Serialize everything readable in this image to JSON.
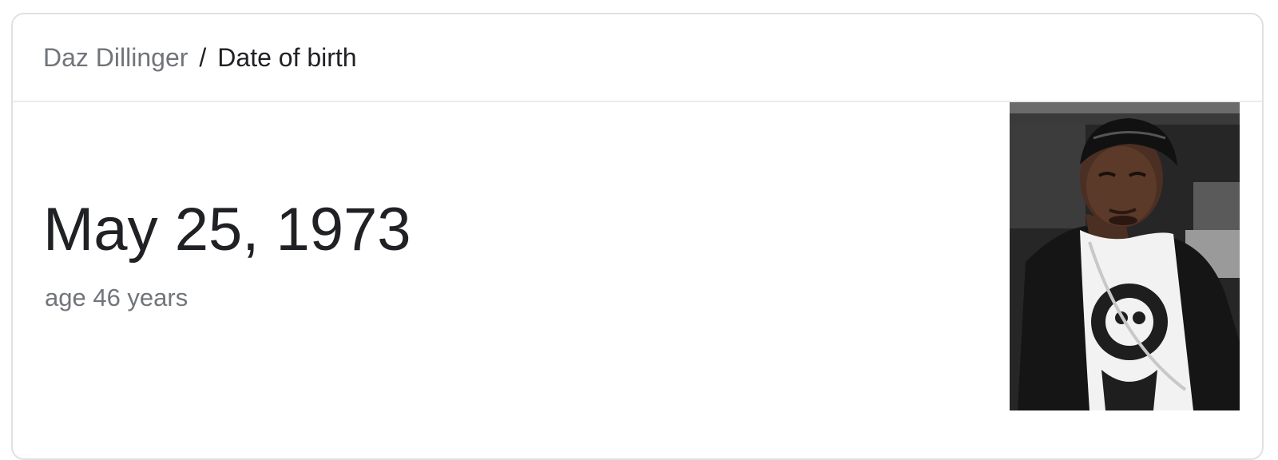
{
  "breadcrumb": {
    "entity": "Daz Dillinger",
    "separator": "/",
    "attribute": "Date of birth"
  },
  "answer": {
    "value": "May 25, 1973",
    "subtext": "age 46 years"
  },
  "image": {
    "subject": "portrait-photo"
  },
  "colors": {
    "text_primary": "#202124",
    "text_secondary": "#70757a",
    "border": "#dfe1e5"
  }
}
